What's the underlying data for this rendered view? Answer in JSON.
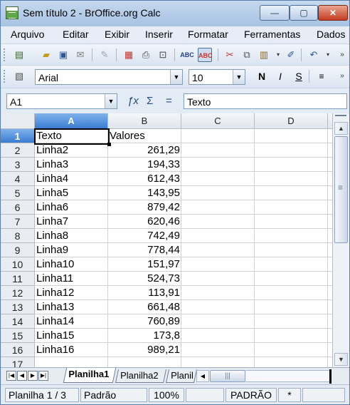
{
  "window": {
    "title": "Sem título 2 - BrOffice.org Calc",
    "controls": {
      "minimize": "—",
      "maximize": "▢",
      "close": "✕"
    }
  },
  "menu": [
    "Arquivo",
    "Editar",
    "Exibir",
    "Inserir",
    "Formatar",
    "Ferramentas",
    "Dados"
  ],
  "toolbar_standard": {
    "icons": [
      "new-icon",
      "open-icon",
      "save-icon",
      "email-icon",
      "edit-file-icon",
      "export-pdf-icon",
      "print-icon",
      "page-preview-icon",
      "spellcheck-icon",
      "autospellcheck-icon",
      "cut-icon",
      "copy-icon",
      "paste-icon",
      "format-paintbrush-icon",
      "undo-icon"
    ]
  },
  "toolbar_format": {
    "font_name": "Arial",
    "font_size": "10",
    "bold_label": "N",
    "italic_label": "I",
    "underline_label": "S"
  },
  "formula_bar": {
    "name_box": "A1",
    "content": "Texto"
  },
  "grid": {
    "columns": [
      "A",
      "B",
      "C",
      "D"
    ],
    "selected_column": "A",
    "selected_row": "1",
    "row_numbers": [
      "1",
      "2",
      "3",
      "4",
      "5",
      "6",
      "7",
      "8",
      "9",
      "10",
      "11",
      "12",
      "13",
      "14",
      "15",
      "16",
      "17"
    ],
    "header_row": {
      "a": "Texto",
      "b": "Valores"
    },
    "rows": [
      {
        "a": "Linha2",
        "b": "261,29"
      },
      {
        "a": "Linha3",
        "b": "194,33"
      },
      {
        "a": "Linha4",
        "b": "612,43"
      },
      {
        "a": "Linha5",
        "b": "143,95"
      },
      {
        "a": "Linha6",
        "b": "879,42"
      },
      {
        "a": "Linha7",
        "b": "620,46"
      },
      {
        "a": "Linha8",
        "b": "742,49"
      },
      {
        "a": "Linha9",
        "b": "778,44"
      },
      {
        "a": "Linha10",
        "b": "151,97"
      },
      {
        "a": "Linha11",
        "b": "524,73"
      },
      {
        "a": "Linha12",
        "b": "113,91"
      },
      {
        "a": "Linha13",
        "b": "661,48"
      },
      {
        "a": "Linha14",
        "b": "760,89"
      },
      {
        "a": "Linha15",
        "b": "173,8"
      },
      {
        "a": "Linha16",
        "b": "989,21"
      }
    ]
  },
  "sheet_tabs": [
    "Planilha1",
    "Planilha2",
    "Planil"
  ],
  "active_sheet": "Planilha1",
  "status": {
    "sheet": "Planilha 1 / 3",
    "style": "Padrão",
    "zoom": "100%",
    "mode": "PADRÃO",
    "modified": "*"
  }
}
